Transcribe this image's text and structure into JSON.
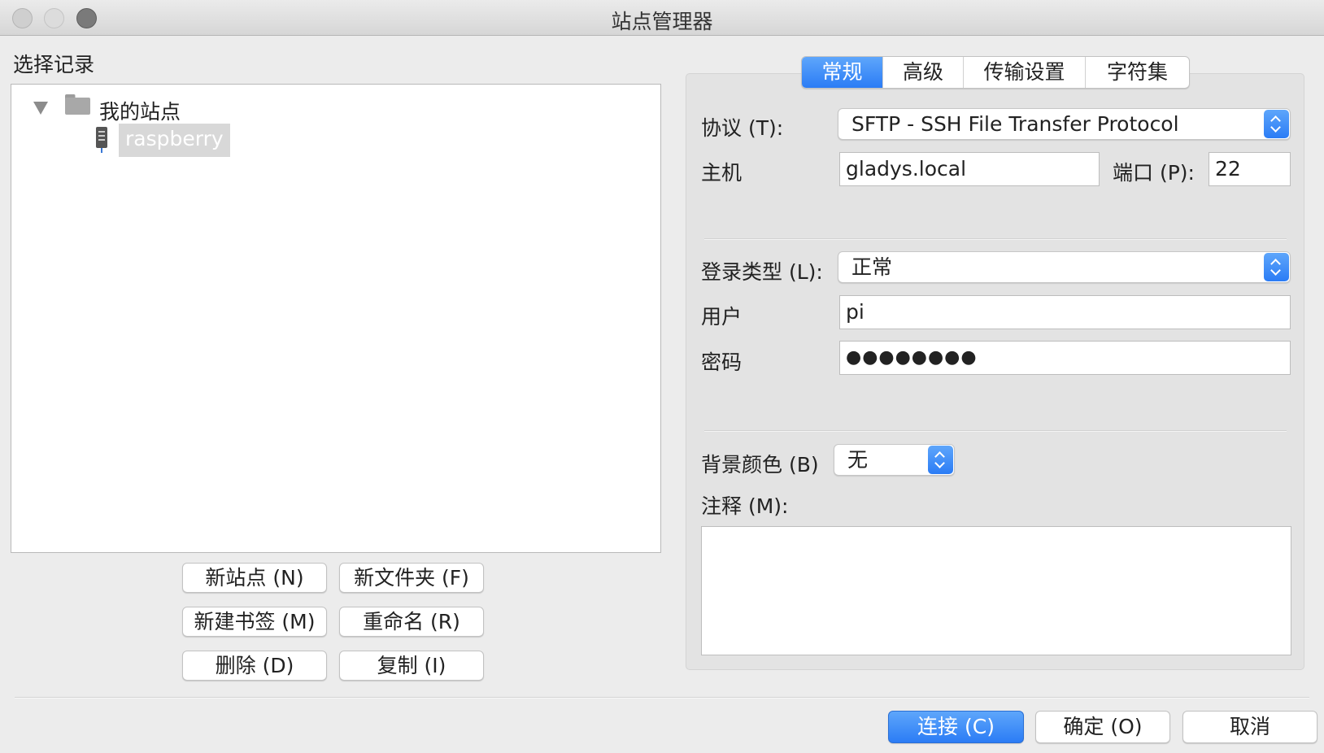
{
  "window": {
    "title": "站点管理器"
  },
  "left": {
    "heading": "选择记录",
    "tree": {
      "folder_label": "我的站点",
      "site_label": "raspberry"
    },
    "buttons": {
      "new_site": "新站点 (N)",
      "new_folder": "新文件夹 (F)",
      "new_bookmark": "新建书签 (M)",
      "rename": "重命名 (R)",
      "delete": "删除 (D)",
      "copy": "复制 (I)"
    }
  },
  "tabs": [
    "常规",
    "高级",
    "传输设置",
    "字符集"
  ],
  "form": {
    "protocol_label": "协议 (T):",
    "protocol_value": "SFTP - SSH File Transfer Protocol",
    "host_label": "主机",
    "host_value": "gladys.local",
    "port_label": "端口 (P):",
    "port_value": "22",
    "logon_type_label": "登录类型 (L):",
    "logon_type_value": "正常",
    "user_label": "用户",
    "user_value": "pi",
    "password_label": "密码",
    "password_value": "●●●●●●●●",
    "bg_color_label": "背景颜色 (B)",
    "bg_color_value": "无",
    "comments_label": "注释 (M):"
  },
  "footer": {
    "connect": "连接 (C)",
    "ok": "确定 (O)",
    "cancel": "取消"
  },
  "colors": {
    "accent": "#2b7cf5",
    "selection": "#d8d8d8"
  }
}
